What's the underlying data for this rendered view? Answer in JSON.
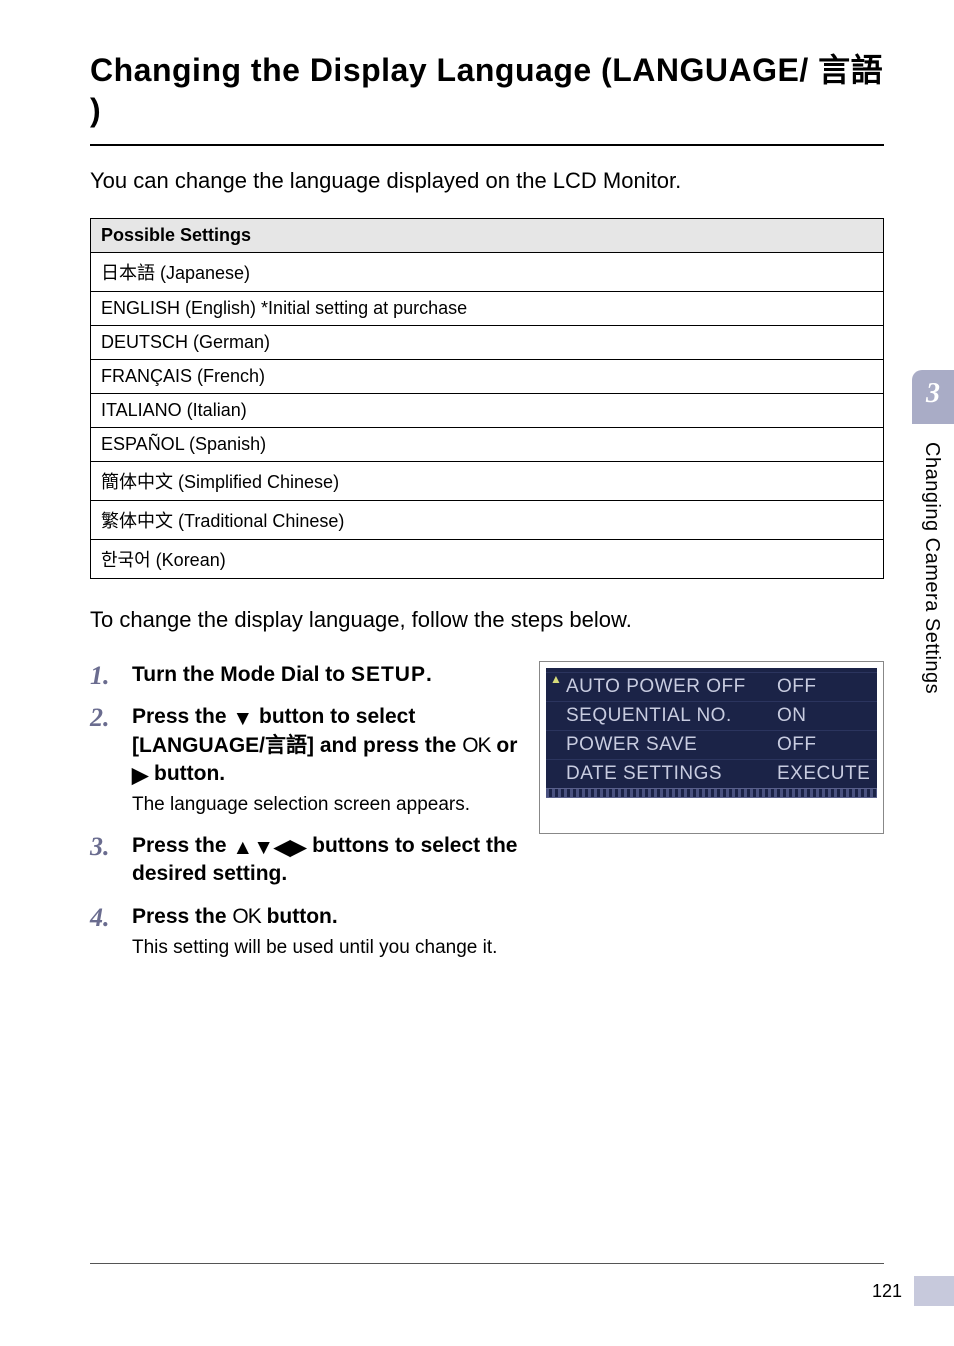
{
  "title": "Changing the Display Language (LANGUAGE/ 言語 )",
  "intro": "You can change the language displayed on the LCD Monitor.",
  "settings_header": "Possible Settings",
  "settings_rows": [
    "日本語 (Japanese)",
    "ENGLISH (English) *Initial setting at purchase",
    "DEUTSCH (German)",
    "FRANÇAIS (French)",
    "ITALIANO (Italian)",
    "ESPAÑOL (Spanish)",
    "簡体中文 (Simplified Chinese)",
    "繁体中文 (Traditional Chinese)",
    "한국어 (Korean)"
  ],
  "lead": "To change the display language, follow the steps below.",
  "steps": {
    "s1": {
      "prefix": "Turn the Mode Dial to ",
      "mode": "SETUP",
      "suffix": "."
    },
    "s2": {
      "l1a": "Press the ",
      "l1b": " button to select [LANGUAGE/言語] and press the ",
      "ok": "OK",
      "l1c": " or ",
      "l1d": " button.",
      "body": "The language selection screen appears."
    },
    "s3": {
      "a": "Press the ",
      "b": " buttons to select the desired setting."
    },
    "s4": {
      "a": "Press the ",
      "ok": "OK",
      "b": " button.",
      "body": "This setting will be used until you change it."
    }
  },
  "lcd": {
    "r1": {
      "label": "AUTO POWER OFF",
      "val": "OFF"
    },
    "r2": {
      "label": "SEQUENTIAL NO.",
      "val": "ON"
    },
    "r3": {
      "label": "POWER SAVE",
      "val": "OFF"
    },
    "r4": {
      "label": "DATE SETTINGS",
      "val": "EXECUTE"
    }
  },
  "side_tab": {
    "num": "3",
    "text": "Changing Camera Settings"
  },
  "page_number": "121"
}
